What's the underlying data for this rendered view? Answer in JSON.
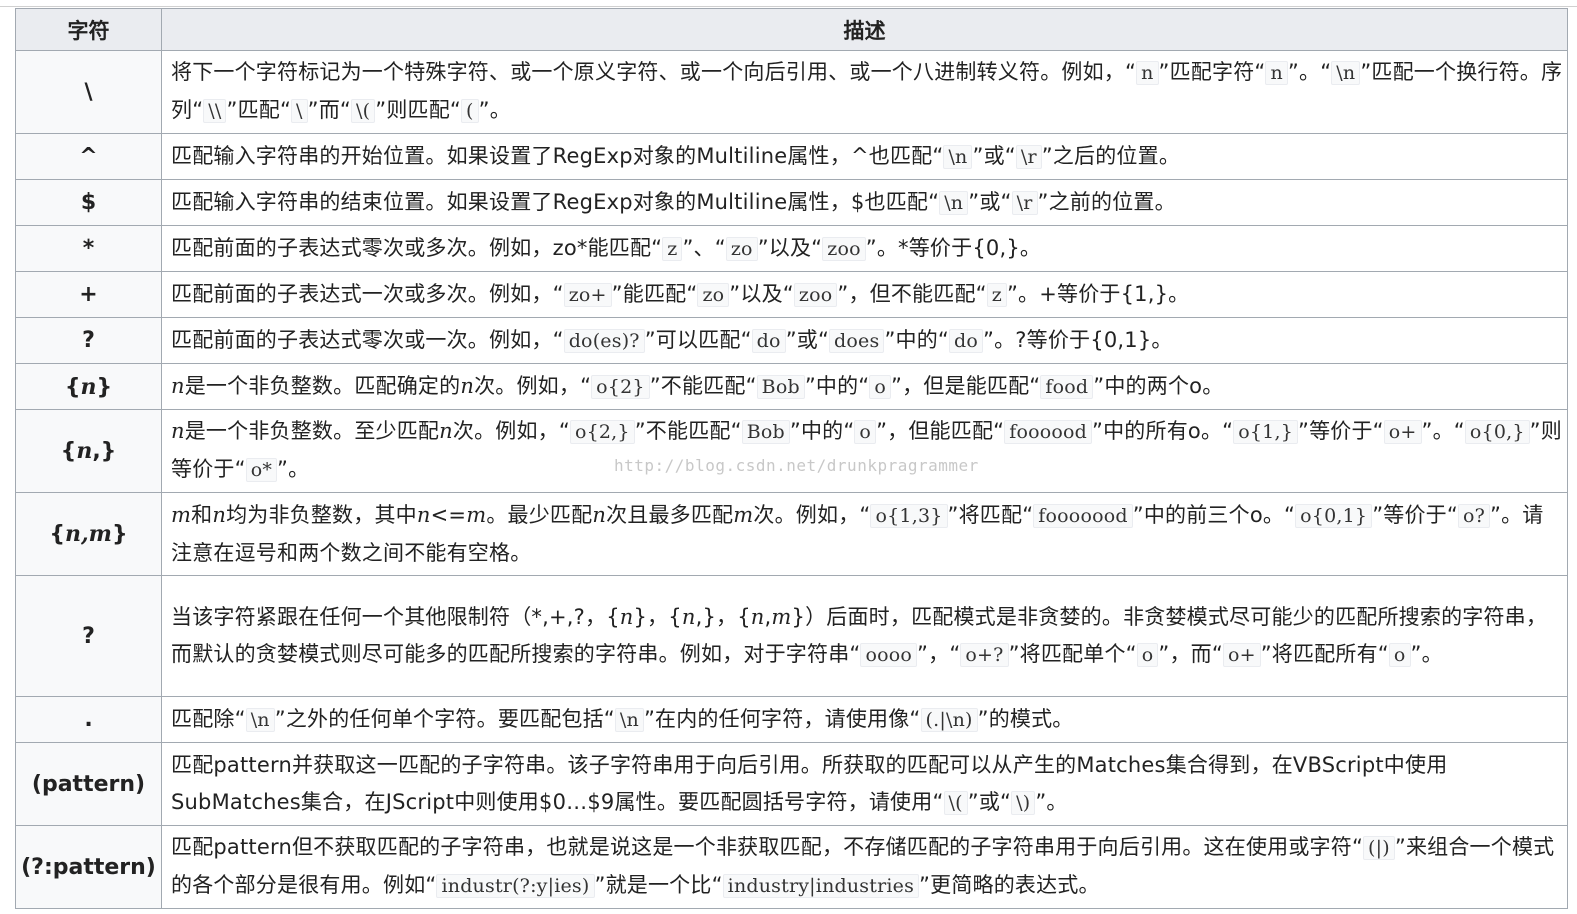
{
  "header": {
    "col1": "字符",
    "col2": "描述"
  },
  "watermark": "http://blog.csdn.net/drunkpragrammer",
  "rows": [
    {
      "sym": "\\",
      "desc": [
        "将下一个字符标记为一个特殊字符、或一个原义字符、或一个向后引用、或一个八进制转义符。例如，“",
        {
          "c": "n"
        },
        "”匹配字符“",
        {
          "c": "n"
        },
        "”。“",
        {
          "c": "\\n"
        },
        "”匹配一个换行符。序列“",
        {
          "c": "\\\\"
        },
        "”匹配“",
        {
          "c": "\\"
        },
        "”而“",
        {
          "c": "\\("
        },
        "”则匹配“",
        {
          "c": "("
        },
        "”。"
      ]
    },
    {
      "sym": "^",
      "desc": [
        "匹配输入字符串的开始位置。如果设置了RegExp对象的Multiline属性，^也匹配“",
        {
          "c": "\\n"
        },
        "”或“",
        {
          "c": "\\r"
        },
        "”之后的位置。"
      ]
    },
    {
      "sym": "$",
      "desc": [
        "匹配输入字符串的结束位置。如果设置了RegExp对象的Multiline属性，$也匹配“",
        {
          "c": "\\n"
        },
        "”或“",
        {
          "c": "\\r"
        },
        "”之前的位置。"
      ]
    },
    {
      "sym": "*",
      "desc": [
        "匹配前面的子表达式零次或多次。例如，zo*能匹配“",
        {
          "c": "z"
        },
        "”、“",
        {
          "c": "zo"
        },
        "”以及“",
        {
          "c": "zoo"
        },
        "”。*等价于{0,}。"
      ]
    },
    {
      "sym": "+",
      "desc": [
        "匹配前面的子表达式一次或多次。例如，“",
        {
          "c": "zo+"
        },
        "”能匹配“",
        {
          "c": "zo"
        },
        "”以及“",
        {
          "c": "zoo"
        },
        "”，但不能匹配“",
        {
          "c": "z"
        },
        "”。+等价于{1,}。"
      ]
    },
    {
      "sym": "?",
      "desc": [
        "匹配前面的子表达式零次或一次。例如，“",
        {
          "c": "do(es)?"
        },
        "”可以匹配“",
        {
          "c": "do"
        },
        "”或“",
        {
          "c": "does"
        },
        "”中的“",
        {
          "c": "do"
        },
        "”。?等价于{0,1}。"
      ]
    },
    {
      "sym": "{n}",
      "symItalic": "n",
      "symPre": "{",
      "symPost": "}",
      "desc": [
        {
          "i": "n"
        },
        "是一个非负整数。匹配确定的",
        {
          "i": "n"
        },
        "次。例如，“",
        {
          "c": "o{2}"
        },
        "”不能匹配“",
        {
          "c": "Bob"
        },
        "”中的“",
        {
          "c": "o"
        },
        "”，但是能匹配“",
        {
          "c": "food"
        },
        "”中的两个o。"
      ]
    },
    {
      "sym": "{n,}",
      "symItalic": "n",
      "symPre": "{",
      "symPost": ",}",
      "desc": [
        {
          "i": "n"
        },
        "是一个非负整数。至少匹配",
        {
          "i": "n"
        },
        "次。例如，“",
        {
          "c": "o{2,}"
        },
        "”不能匹配“",
        {
          "c": "Bob"
        },
        "”中的“",
        {
          "c": "o"
        },
        "”，但能匹配“",
        {
          "c": "foooood"
        },
        "”中的所有o。“",
        {
          "c": "o{1,}"
        },
        "”等价于“",
        {
          "c": "o+"
        },
        "”。“",
        {
          "c": "o{0,}"
        },
        "”则等价于“",
        {
          "c": "o*"
        },
        "”。"
      ]
    },
    {
      "sym": "{n,m}",
      "symItalic": "n,m",
      "symPre": "{",
      "symPost": "}",
      "desc": [
        {
          "i": "m"
        },
        "和",
        {
          "i": "n"
        },
        "均为非负整数，其中",
        {
          "i": "n"
        },
        "<=",
        {
          "i": "m"
        },
        "。最少匹配",
        {
          "i": "n"
        },
        "次且最多匹配",
        {
          "i": "m"
        },
        "次。例如，“",
        {
          "c": "o{1,3}"
        },
        "”将匹配“",
        {
          "c": "fooooood"
        },
        "”中的前三个o。“",
        {
          "c": "o{0,1}"
        },
        "”等价于“",
        {
          "c": "o?"
        },
        "”。请注意在逗号和两个数之间不能有空格。"
      ]
    },
    {
      "sym": "?",
      "desc": [
        "当该字符紧跟在任何一个其他限制符（*,+,?，{",
        {
          "i": "n"
        },
        "}，{",
        {
          "i": "n"
        },
        ",}，{",
        {
          "i": "n"
        },
        ",",
        {
          "i": "m"
        },
        "}）后面时，匹配模式是非贪婪的。非贪婪模式尽可能少的匹配所搜索的字符串，而默认的贪婪模式则尽可能多的匹配所搜索的字符串。例如，对于字符串“",
        {
          "c": "oooo"
        },
        "”，“",
        {
          "c": "o+?"
        },
        "”将匹配单个“",
        {
          "c": "o"
        },
        "”，而“",
        {
          "c": "o+"
        },
        "”将匹配所有“",
        {
          "c": "o"
        },
        "”。"
      ]
    },
    {
      "sym": ".",
      "desc": [
        "匹配除“",
        {
          "c": "\\n"
        },
        "”之外的任何单个字符。要匹配包括“",
        {
          "c": "\\n"
        },
        "”在内的任何字符，请使用像“",
        {
          "c": "(.|\\n)"
        },
        "”的模式。"
      ]
    },
    {
      "sym": "(pattern)",
      "desc": [
        "匹配pattern并获取这一匹配的子字符串。该子字符串用于向后引用。所获取的匹配可以从产生的Matches集合得到，在VBScript中使用SubMatches集合，在JScript中则使用$0…$9属性。要匹配圆括号字符，请使用“",
        {
          "c": "\\("
        },
        "”或“",
        {
          "c": "\\)"
        },
        "”。"
      ]
    },
    {
      "sym": "(?:pattern)",
      "desc": [
        "匹配pattern但不获取匹配的子字符串，也就是说这是一个非获取匹配，不存储匹配的子字符串用于向后引用。这在使用或字符“",
        {
          "c": "(|)"
        },
        "”来组合一个模式的各个部分是很有用。例如“",
        {
          "c": "industr(?:y|ies)"
        },
        "”就是一个比“",
        {
          "c": "industry|industries"
        },
        "”更简略的表达式。"
      ]
    }
  ]
}
